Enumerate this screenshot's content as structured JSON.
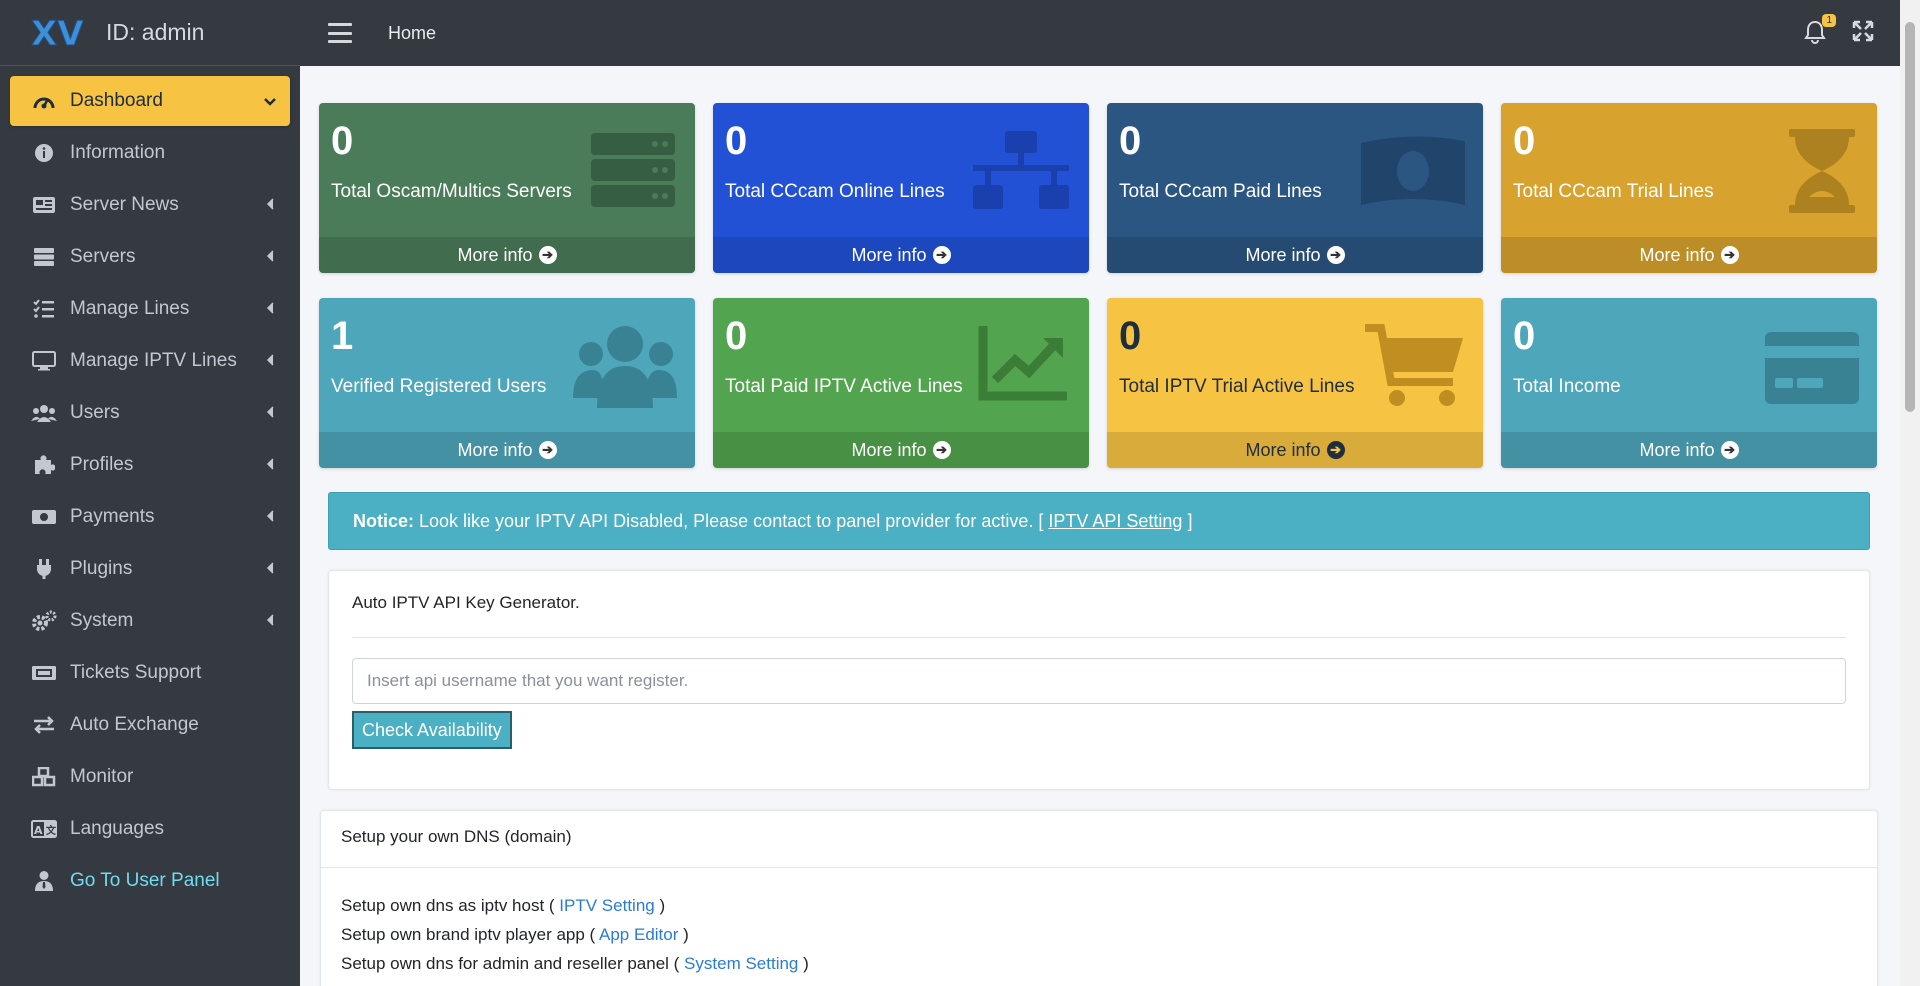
{
  "brand": {
    "title": "ID: admin"
  },
  "sidebar": {
    "items": [
      {
        "label": "Dashboard",
        "icon": "gauge-icon",
        "chevron": "down"
      },
      {
        "label": "Information",
        "icon": "info-icon"
      },
      {
        "label": "Server News",
        "icon": "newspaper-icon",
        "chevron": "left"
      },
      {
        "label": "Servers",
        "icon": "server-icon",
        "chevron": "left"
      },
      {
        "label": "Manage Lines",
        "icon": "list-check-icon",
        "chevron": "left"
      },
      {
        "label": "Manage IPTV Lines",
        "icon": "monitor-icon",
        "chevron": "left"
      },
      {
        "label": "Users",
        "icon": "users-icon",
        "chevron": "left"
      },
      {
        "label": "Profiles",
        "icon": "puzzle-icon",
        "chevron": "left"
      },
      {
        "label": "Payments",
        "icon": "money-icon",
        "chevron": "left"
      },
      {
        "label": "Plugins",
        "icon": "plug-icon",
        "chevron": "left"
      },
      {
        "label": "System",
        "icon": "gears-icon",
        "chevron": "left"
      },
      {
        "label": "Tickets Support",
        "icon": "ticket-icon"
      },
      {
        "label": "Auto Exchange",
        "icon": "exchange-icon"
      },
      {
        "label": "Monitor",
        "icon": "cubes-icon"
      },
      {
        "label": "Languages",
        "icon": "language-icon"
      },
      {
        "label": "Go To User Panel",
        "icon": "user-tie-icon"
      }
    ]
  },
  "header": {
    "home": "Home",
    "notifications_count": "1"
  },
  "stats": [
    {
      "value": "0",
      "title": "Total Oscam/Multics Servers",
      "more": "More info",
      "color": "#4a7c59",
      "icon": "server-icon"
    },
    {
      "value": "0",
      "title": "Total CCcam Online Lines",
      "more": "More info",
      "color": "#2251d6",
      "icon": "network-icon"
    },
    {
      "value": "0",
      "title": "Total CCcam Paid Lines",
      "more": "More info",
      "color": "#2c5682",
      "icon": "money-bill-icon"
    },
    {
      "value": "0",
      "title": "Total CCcam Trial Lines",
      "more": "More info",
      "color": "#d8a22e",
      "icon": "hourglass-icon"
    },
    {
      "value": "1",
      "title": "Verified Registered Users",
      "more": "More info",
      "color": "#4ea6ba",
      "icon": "users-icon"
    },
    {
      "value": "0",
      "title": "Total Paid IPTV Active Lines",
      "more": "More info",
      "color": "#52a54e",
      "icon": "chart-line-icon"
    },
    {
      "value": "0",
      "title": "Total IPTV Trial Active Lines",
      "more": "More info",
      "color": "#f6c342",
      "icon": "cart-icon"
    },
    {
      "value": "0",
      "title": "Total Income",
      "more": "More info",
      "color": "#4ea6ba",
      "icon": "credit-card-icon"
    }
  ],
  "notice": {
    "label": "Notice:",
    "text": "Look like your IPTV API Disabled, Please contact to panel provider for active. [",
    "link": "IPTV API Setting",
    "suffix": "]"
  },
  "api_card": {
    "title": "Auto IPTV API Key Generator.",
    "placeholder": "Insert api username that you want register.",
    "button": "Check Availability"
  },
  "dns_card": {
    "title": "Setup your own DNS (domain)",
    "lines": [
      {
        "prefix": "Setup own dns as iptv host (",
        "link": "IPTV Setting",
        "suffix": ")"
      },
      {
        "prefix": "Setup own brand iptv player app (",
        "link": "App Editor",
        "suffix": ")"
      },
      {
        "prefix": "Setup own dns for admin and reseller panel (",
        "link": "System Setting",
        "suffix": ")"
      }
    ]
  }
}
